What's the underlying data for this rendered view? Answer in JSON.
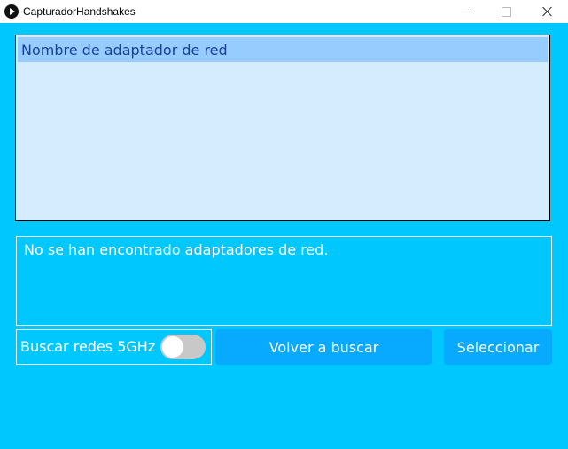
{
  "window": {
    "title": "CapturadorHandshakes",
    "icon": "play-circle-icon"
  },
  "adapter_list": {
    "header": "Nombre de adaptador de red",
    "items": []
  },
  "message": "No se han encontrado adaptadores de red.",
  "toggle_5ghz": {
    "label": "Buscar redes 5GHz",
    "enabled": false
  },
  "buttons": {
    "rescan": "Volver a buscar",
    "select": "Seleccionar"
  },
  "colors": {
    "background": "#00c8ff",
    "list_background": "#d5ecff",
    "list_header": "#96ccff",
    "button": "#08aaff"
  }
}
